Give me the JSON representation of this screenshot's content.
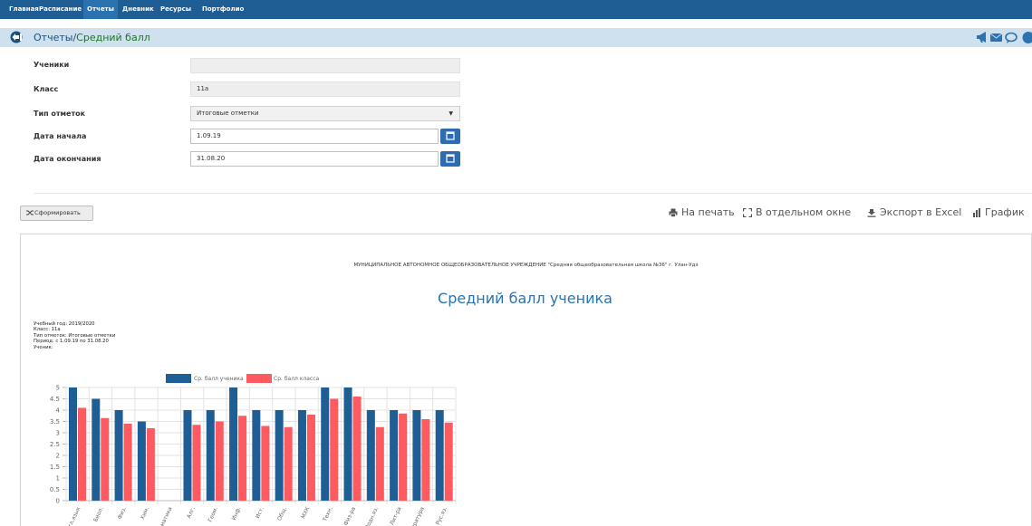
{
  "nav": {
    "items": [
      {
        "label": "Главная",
        "active": false
      },
      {
        "label": "Расписание",
        "active": false
      },
      {
        "label": "Отчеты",
        "active": true
      },
      {
        "label": "Дневник",
        "active": false
      },
      {
        "label": "Ресурсы",
        "active": false
      },
      {
        "label": "Портфолио",
        "active": false
      }
    ]
  },
  "breadcrumb": {
    "parent": "Отчеты",
    "separator": "/",
    "current": "Средний балл"
  },
  "header_icons": [
    "megaphone-icon",
    "envelope-icon",
    "chat-icon",
    "user-icon"
  ],
  "form": {
    "students_label": "Ученики",
    "students_value": "",
    "class_label": "Класс",
    "class_value": "11а",
    "mark_type_label": "Тип отметок",
    "mark_type_value": "Итоговые отметки",
    "start_label": "Дата начала",
    "start_value": "1.09.19",
    "end_label": "Дата окончания",
    "end_value": "31.08.20"
  },
  "generate_button": "Сформировать",
  "toolbar": {
    "print": "На печать",
    "window": "В отдельном окне",
    "excel": "Экспорт в Excel",
    "chart": "График"
  },
  "report": {
    "organization": "МУНИЦИПАЛЬНОЕ АВТОНОМНОЕ ОБЩЕОБРАЗОВАТЕЛЬНОЕ УЧРЕЖДЕНИЕ \"Средняя общеобразовательная школа №36\" г. Улан-Удэ",
    "title": "Средний балл ученика",
    "meta": [
      "Учебный год: 2019/2020",
      "Класс: 11а",
      "Тип отметок: Итоговые отметки",
      "Период: с 1.09.19 по 31.08.20",
      "Ученик:"
    ]
  },
  "colors": {
    "nav": "#1f5d95",
    "student": "#1f5d95",
    "class": "#ff5a5f",
    "accent": "#2a72b0"
  },
  "chart_data": {
    "type": "bar",
    "categories": [
      "Англ.язык",
      "Биол.",
      "Физ.",
      "Хим.",
      "Информатика",
      "Алг.",
      "Геом.",
      "Инф.",
      "Ист.",
      "Общ.",
      "МХК",
      "Техн.",
      "Физ-ра",
      "Родн.яз.",
      "Лит-ра",
      "Литература",
      "Рус.яз."
    ],
    "series": [
      {
        "name": "Ср. балл ученика",
        "values": [
          5,
          4.5,
          4,
          3.5,
          null,
          4,
          4,
          5,
          4,
          4,
          4,
          5,
          5,
          4,
          4,
          4,
          4
        ]
      },
      {
        "name": "Ср. балл класса",
        "values": [
          4.1,
          3.65,
          3.4,
          3.2,
          null,
          3.35,
          3.5,
          3.75,
          3.3,
          3.25,
          3.8,
          4.5,
          4.6,
          3.25,
          3.85,
          3.6,
          3.45
        ]
      }
    ],
    "yticks": [
      "0",
      "0.5",
      "1",
      "1.5",
      "2",
      "2.5",
      "3",
      "3.5",
      "4",
      "4.5",
      "5"
    ],
    "ylim": [
      0,
      5
    ],
    "grid": true,
    "legend": "top"
  }
}
